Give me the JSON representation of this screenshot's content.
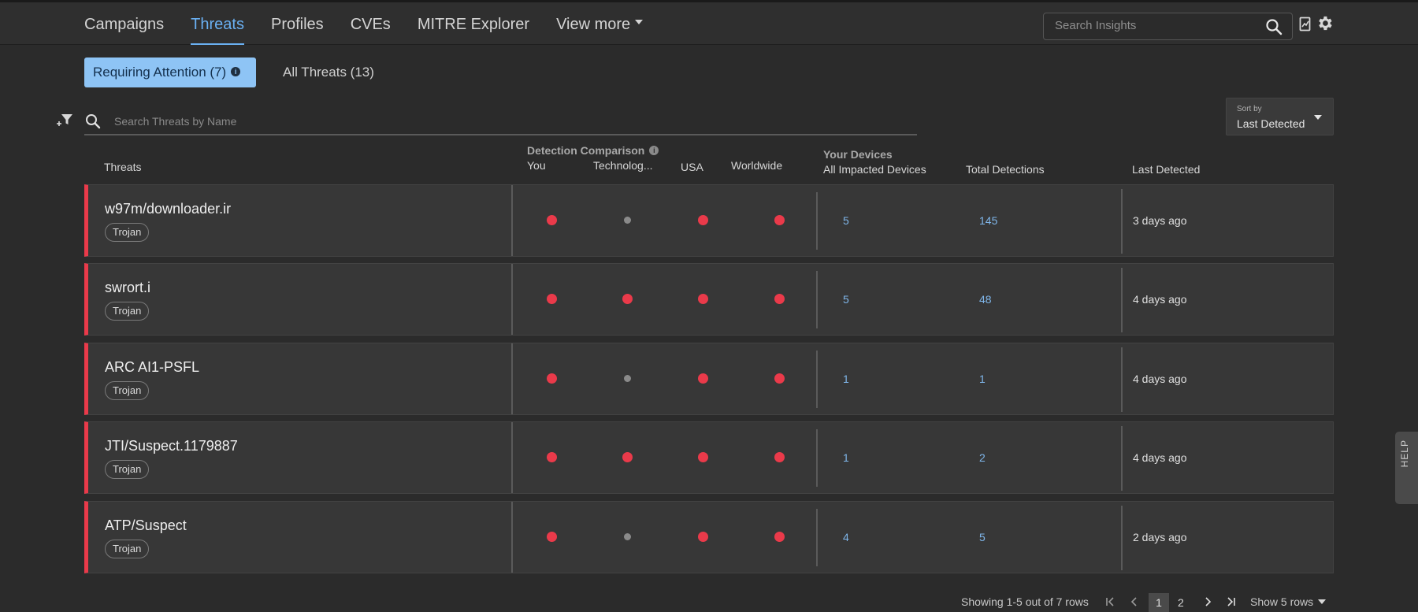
{
  "nav": {
    "tabs": [
      "Campaigns",
      "Threats",
      "Profiles",
      "CVEs",
      "MITRE Explorer",
      "View more"
    ],
    "search_placeholder": "Search Insights"
  },
  "subtabs": {
    "requiring": "Requiring Attention (7)",
    "all": "All Threats (13)"
  },
  "threat_search_placeholder": "Search Threats by Name",
  "sort": {
    "label": "Sort by",
    "value": "Last Detected"
  },
  "headers": {
    "threats": "Threats",
    "detection_comparison": "Detection Comparison",
    "you": "You",
    "technology": "Technolog...",
    "usa": "USA",
    "worldwide": "Worldwide",
    "your_devices": "Your Devices",
    "all_impacted": "All Impacted Devices",
    "total_detections": "Total Detections",
    "last_detected": "Last Detected"
  },
  "rows": [
    {
      "name": "w97m/downloader.ir",
      "tag": "Trojan",
      "dots": [
        "red",
        "grey",
        "red",
        "red"
      ],
      "devices": "5",
      "detections": "145",
      "last": "3 days ago"
    },
    {
      "name": "swrort.i",
      "tag": "Trojan",
      "dots": [
        "red",
        "red",
        "red",
        "red"
      ],
      "devices": "5",
      "detections": "48",
      "last": "4 days ago"
    },
    {
      "name": "ARC AI1-PSFL",
      "tag": "Trojan",
      "dots": [
        "red",
        "grey",
        "red",
        "red"
      ],
      "devices": "1",
      "detections": "1",
      "last": "4 days ago"
    },
    {
      "name": "JTI/Suspect.1179887",
      "tag": "Trojan",
      "dots": [
        "red",
        "red",
        "red",
        "red"
      ],
      "devices": "1",
      "detections": "2",
      "last": "4 days ago"
    },
    {
      "name": "ATP/Suspect",
      "tag": "Trojan",
      "dots": [
        "red",
        "grey",
        "red",
        "red"
      ],
      "devices": "4",
      "detections": "5",
      "last": "2 days ago"
    }
  ],
  "footer": {
    "showing": "Showing 1-5 out of 7 rows",
    "pages": [
      "1",
      "2"
    ],
    "show_rows": "Show 5 rows"
  },
  "help": "HELP",
  "colors": {
    "accent": "#6ab0f2",
    "severity": "#ea3a4a",
    "link": "#7fb6ea"
  }
}
